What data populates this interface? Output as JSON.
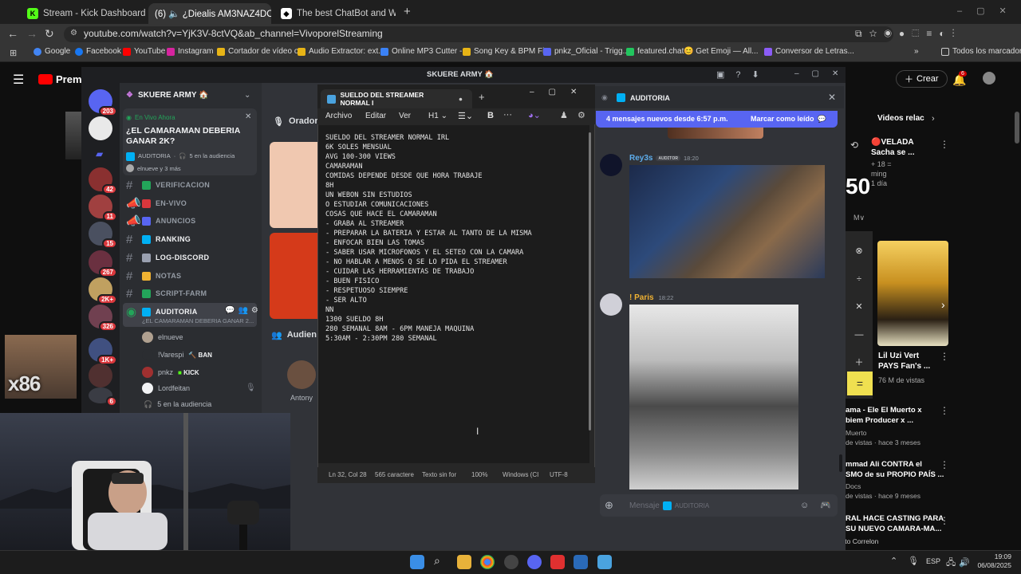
{
  "browser": {
    "tabs": [
      {
        "label": "Stream - Kick Dashboard"
      },
      {
        "label": "(6) 🔈 ¿Diealis AM3NAZ4DO? 🔇"
      },
      {
        "label": "The best ChatBot and Widgets"
      }
    ],
    "url": "youtube.com/watch?v=YjK3V-8ctVQ&ab_channel=VivoporelStreaming",
    "bookmarks": [
      "Google",
      "Facebook",
      "YouTube",
      "Instagram",
      "Cortador de vídeo o...",
      "Audio Extractor: ext...",
      "Online MP3 Cutter -...",
      "Song Key & BPM Fi...",
      "pnkz_Oficial - Trigg...",
      "featured.chat",
      "😊 Get Emoji — All...",
      "Conversor de Letras..."
    ],
    "all_bookmarks": "Todos los marcadores"
  },
  "youtube": {
    "premium": "Premi",
    "create": "Crear",
    "notif_count": "6",
    "related_title": "Videos relac",
    "side_items": [
      {
        "title": "🔴VELADA",
        "sub": "Sacha se ...",
        "meta": "ming",
        "meta2": "1 día"
      },
      {
        "title": "Lil Uzi Vert",
        "sub": "PAYS Fan's ...",
        "meta": "76 M de vistas"
      },
      {
        "title": "ama - Ele El Muerto x",
        "sub": "biem Producer x ...",
        "meta": "Muerto",
        "meta2": "de vistas · hace 3 meses"
      },
      {
        "title": "mmad Ali CONTRA el",
        "sub": "SMO de su PROPIO PAÍS ...",
        "meta": "Docs",
        "meta2": "de vistas · hace 9 meses"
      },
      {
        "title": "RAL HACE CASTING PARA",
        "sub": "SU NUEVO CAMARA-MA...",
        "meta": "Dibujito Correlon"
      }
    ],
    "big_number": "50",
    "plus18": "+ 18 ="
  },
  "discord": {
    "window_title": "SKUERE ARMY 🏠",
    "server_name": "SKUERE ARMY 🏠",
    "live": {
      "label": "En Vivo Ahora",
      "title": "¿EL CAMARAMAN DEBERIA GANAR 2K?",
      "channel": "AUDITORIA",
      "audience": "5 en la audiencia",
      "users": "elnueve y 3 más"
    },
    "server_badges": [
      "203",
      "42",
      "11",
      "15",
      "267",
      "2K+",
      "326",
      "1K+",
      "6"
    ],
    "channels": [
      {
        "name": "VERIFICACION"
      },
      {
        "name": "EN-VIVO"
      },
      {
        "name": "ANUNCIOS"
      },
      {
        "name": "RANKING"
      },
      {
        "name": "LOG-DISCORD"
      },
      {
        "name": "NOTAS"
      },
      {
        "name": "SCRIPT-FARM"
      },
      {
        "name": "AUDITORIA"
      }
    ],
    "stage_topic": "¿EL CAMARAMAN DEBERIA GANAR 2...",
    "members": [
      {
        "name": "elnueve"
      },
      {
        "name": "!Varespi",
        "tag": "BAN"
      },
      {
        "name": "pnkz",
        "tag": "KICK"
      },
      {
        "name": "Lordfeitan"
      }
    ],
    "audience_count": "5 en la audiencia",
    "mid_labels": {
      "orador": "Orador",
      "audience": "Audien",
      "antony": "Antony"
    },
    "chat": {
      "header": "AUDITORIA",
      "new_messages": "4 mensajes nuevos desde 6:57 p.m.",
      "mark_read": "Marcar como leído",
      "messages": [
        {
          "author": "Rey3s",
          "tag": "ᴀᴜᴅɪᴛᴏʀ",
          "time": "18:20"
        },
        {
          "author": "! Paris",
          "time": "18:22"
        }
      ],
      "input_placeholder": "Mensaje",
      "input_channel": "AUDITORIA"
    }
  },
  "notepad": {
    "tab_title": "SUELDO DEL STREAMER NORMAL I",
    "menu": [
      "Archivo",
      "Editar",
      "Ver"
    ],
    "heading": "H1",
    "lines": [
      "SUELDO DEL STREAMER NORMAL IRL",
      "",
      "6K SOLES MENSUAL",
      "AVG 100-300 VIEWS",
      "",
      "CAMARAMAN",
      "",
      "COMIDAS DEPENDE DESDE QUE HORA TRABAJE",
      "8H",
      "",
      "UN WEBON SIN ESTUDIOS",
      "O ESTUDIAR COMUNICACIONES",
      "",
      "COSAS QUE HACE EL CAMARAMAN",
      "",
      "- GRABA AL STREAMER",
      "- PREPARAR LA BATERIA Y ESTAR AL TANTO DE LA MISMA",
      "- ENFOCAR BIEN LAS TOMAS",
      "- SABER USAR MICROFONOS Y EL SETEO CON LA CAMARA",
      "- NO HABLAR A MENOS Q SE LO PIDA EL STREAMER",
      "- CUIDAR LAS HERRAMIENTAS DE TRABAJO",
      "- BUEN FISICO",
      "- RESPETUOSO SIEMPRE",
      "- SER ALTO",
      "",
      "NN",
      "",
      "1300 SUELDO 8H",
      "",
      "280 SEMANAL 8AM - 6PM MANEJA MAQUINA",
      "",
      "5:30AM - 2:30PM 280 SEMANAL"
    ],
    "status": {
      "position": "Ln 32, Col 28",
      "chars": "565 caractere",
      "format": "Texto sin for",
      "zoom": "100%",
      "eol": "Windows (CI",
      "encoding": "UTF-8"
    }
  },
  "overlay": {
    "x86": "x86"
  },
  "taskbar": {
    "lang": "ESP",
    "time": "19:09",
    "date": "06/08/2025"
  }
}
